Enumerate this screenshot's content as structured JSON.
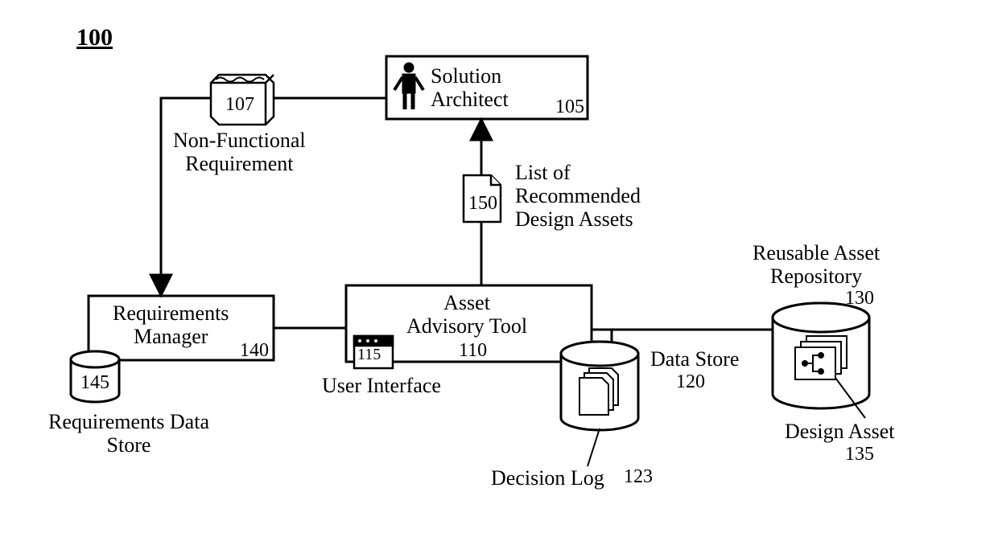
{
  "figure_ref": "100",
  "nodes": {
    "solution_architect": {
      "label": "Solution\nArchitect",
      "ref": "105"
    },
    "nfr": {
      "label": "Non-Functional\nRequirement",
      "ref": "107"
    },
    "rec_list": {
      "label": "List of\nRecommended\nDesign Assets",
      "ref": "150"
    },
    "req_mgr": {
      "label": "Requirements\nManager",
      "ref": "140"
    },
    "req_ds": {
      "label": "Requirements Data\nStore",
      "ref": "145"
    },
    "asset_tool": {
      "label": "Asset\nAdvisory Tool",
      "ref": "110"
    },
    "ui": {
      "label": "User Interface",
      "ref": "115"
    },
    "data_store": {
      "label": "Data Store",
      "ref": "120"
    },
    "decision_log": {
      "label": "Decision Log",
      "ref": "123"
    },
    "repo": {
      "label": "Reusable Asset\nRepository",
      "ref": "130"
    },
    "design_asset": {
      "label": "Design Asset",
      "ref": "135"
    }
  }
}
